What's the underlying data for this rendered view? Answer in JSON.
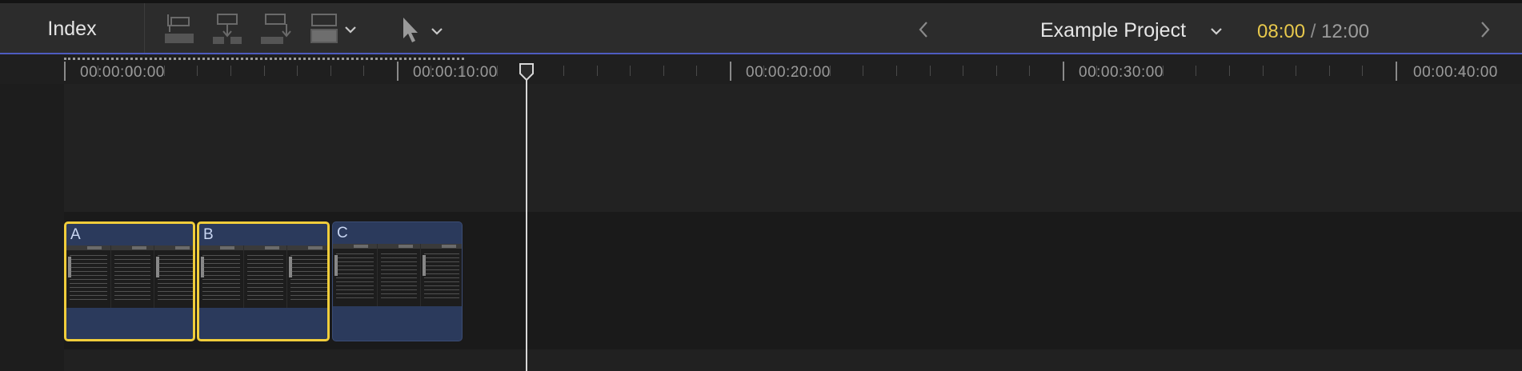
{
  "toolbar": {
    "index_label": "Index",
    "edit_buttons": [
      "connect-clip-icon",
      "insert-clip-icon",
      "append-clip-icon",
      "overwrite-clip-icon"
    ],
    "tool_selector_icon": "arrow-pointer-icon",
    "project_title": "Example Project",
    "timecode_current": "08:00",
    "timecode_separator": "/",
    "timecode_total": "12:00"
  },
  "ruler": {
    "labels": [
      "00:00:00:00",
      "00:00:10:00",
      "00:00:20:00",
      "00:00:30:00",
      "00:00:40:00"
    ]
  },
  "clips": [
    {
      "label": "A",
      "selected": true
    },
    {
      "label": "B",
      "selected": true
    },
    {
      "label": "C",
      "selected": false
    }
  ],
  "colors": {
    "selection": "#f0cd3b",
    "clip_fill": "#2b3a5c",
    "timecode_current": "#e7c84c",
    "accent_line": "#4e5cc0"
  }
}
